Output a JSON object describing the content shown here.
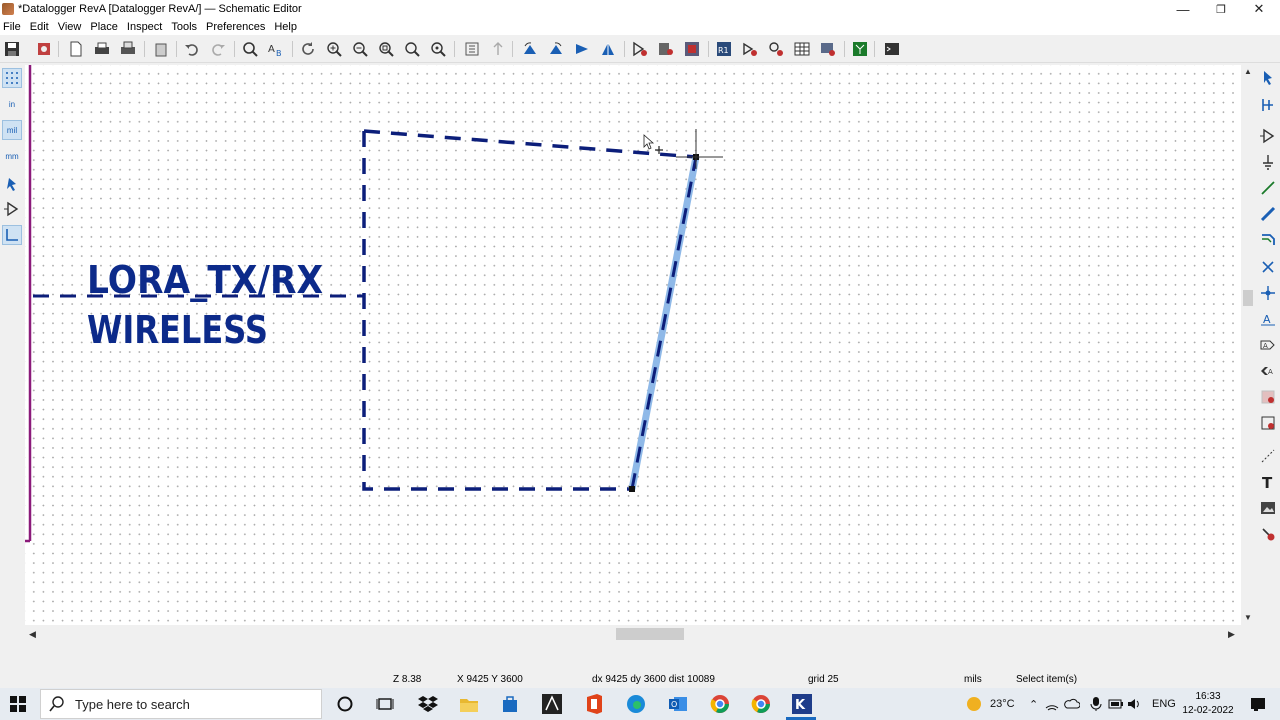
{
  "window": {
    "title": "*Datalogger RevA [Datalogger RevA/] — Schematic Editor",
    "controls": {
      "minimize": "—",
      "maximize": "❐",
      "close": "✕"
    }
  },
  "menu": [
    "File",
    "Edit",
    "View",
    "Place",
    "Inspect",
    "Tools",
    "Preferences",
    "Help"
  ],
  "toolbar": {
    "icons": [
      "save-icon",
      "schematic-setup-icon",
      "page-settings-icon",
      "print-icon",
      "plot-icon",
      "paste-icon",
      "undo-icon",
      "redo-icon",
      "find-icon",
      "find-replace-icon",
      "refresh-icon",
      "zoom-in-icon",
      "zoom-out-icon",
      "zoom-fit-icon",
      "zoom-objects-icon",
      "zoom-selection-icon",
      "hierarchy-navigator-icon",
      "leave-sheet-icon",
      "rotate-ccw-icon",
      "rotate-cw-icon",
      "mirror-v-icon",
      "mirror-h-icon",
      "symbol-editor-icon",
      "symbol-library-browser-icon",
      "footprint-assign-icon",
      "annotate-icon",
      "erc-icon",
      "footprint-editor-icon",
      "bom-icon",
      "edit-fields-icon",
      "pcb-editor-icon",
      "scripting-console-icon"
    ]
  },
  "left_toolbar": {
    "units": {
      "in": "in",
      "mil": "mil",
      "mm": "mm"
    }
  },
  "right_toolbar": {
    "icons": [
      "select-arrow-icon",
      "highlight-net-icon",
      "add-symbol-icon",
      "add-power-icon",
      "add-wire-icon",
      "add-bus-icon",
      "add-bus-entry-icon",
      "no-connect-icon",
      "junction-icon",
      "net-label-icon",
      "global-label-icon",
      "hierarchical-label-icon",
      "hierarchical-sheet-icon",
      "import-sheet-pin-icon",
      "add-graphic-lines-icon",
      "add-text-icon",
      "add-image-icon",
      "delete-icon"
    ]
  },
  "canvas": {
    "sheet_label_line1": "LORA_TX/RX",
    "sheet_label_line2": "WIRELESS"
  },
  "status": {
    "zoom": "Z 8.38",
    "coords": "X 9425  Y 3600",
    "delta": "dx 9425  dy 3600  dist 10089",
    "grid": "grid 25",
    "units": "mils",
    "message": "Select item(s)"
  },
  "taskbar": {
    "search_placeholder": "Type here to search",
    "temperature": "23°C",
    "language": "ENG",
    "time": "16:33",
    "date": "12-02-2022"
  },
  "colors": {
    "sheet_outline": "#0c1e7a",
    "sheet_text": "#0c2a8a",
    "selection": "#8fb9e8",
    "sheet_border_left": "#8b1a7a"
  }
}
